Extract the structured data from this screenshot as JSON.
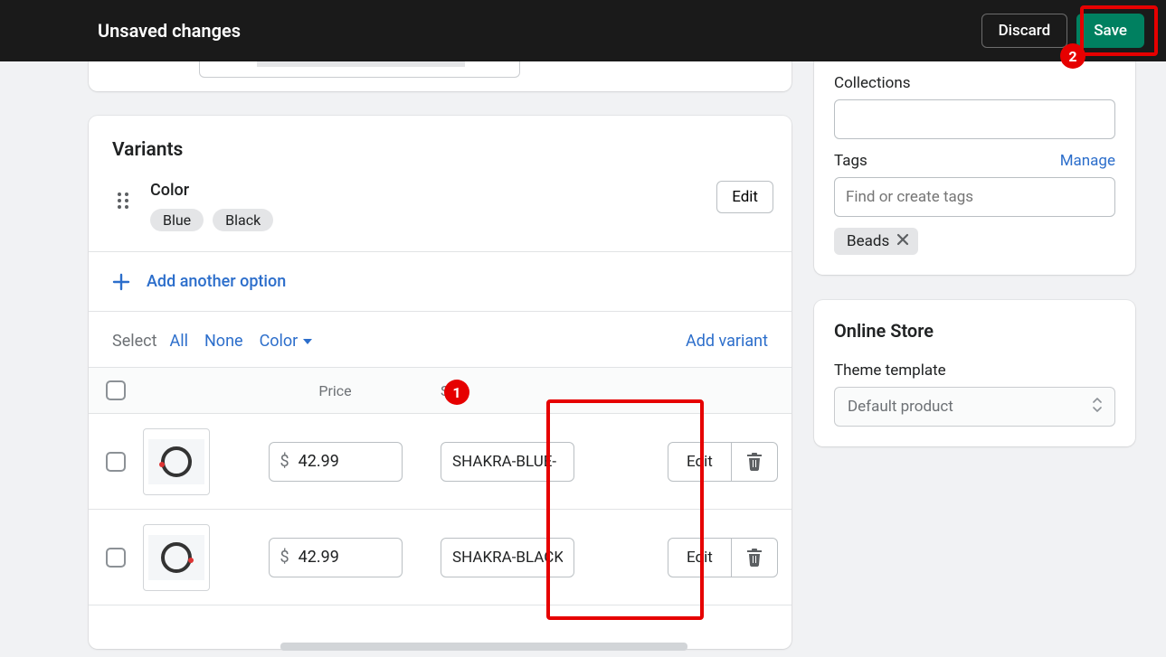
{
  "topbar": {
    "title": "Unsaved changes",
    "discard": "Discard",
    "save": "Save"
  },
  "variants": {
    "title": "Variants",
    "option_name": "Color",
    "option_values": {
      "0": "Blue",
      "1": "Black"
    },
    "edit_label": "Edit",
    "add_option": "Add another option",
    "select_label": "Select",
    "filter_all": "All",
    "filter_none": "None",
    "filter_color": "Color",
    "add_variant": "Add variant",
    "columns": {
      "price": "Price",
      "sku": "SKU"
    },
    "currency": "$",
    "rows": {
      "0": {
        "price": "42.99",
        "sku": "SHAKRA-BLUE-",
        "edit": "Edit"
      },
      "1": {
        "price": "42.99",
        "sku": "SHAKRA-BLACK",
        "edit": "Edit"
      }
    }
  },
  "sidebar": {
    "collections_label": "Collections",
    "tags_label": "Tags",
    "manage": "Manage",
    "tags_placeholder": "Find or create tags",
    "tag0": "Beads"
  },
  "online": {
    "title": "Online Store",
    "theme_label": "Theme template",
    "theme_value": "Default product"
  },
  "annotations": {
    "b1": "1",
    "b2": "2"
  }
}
